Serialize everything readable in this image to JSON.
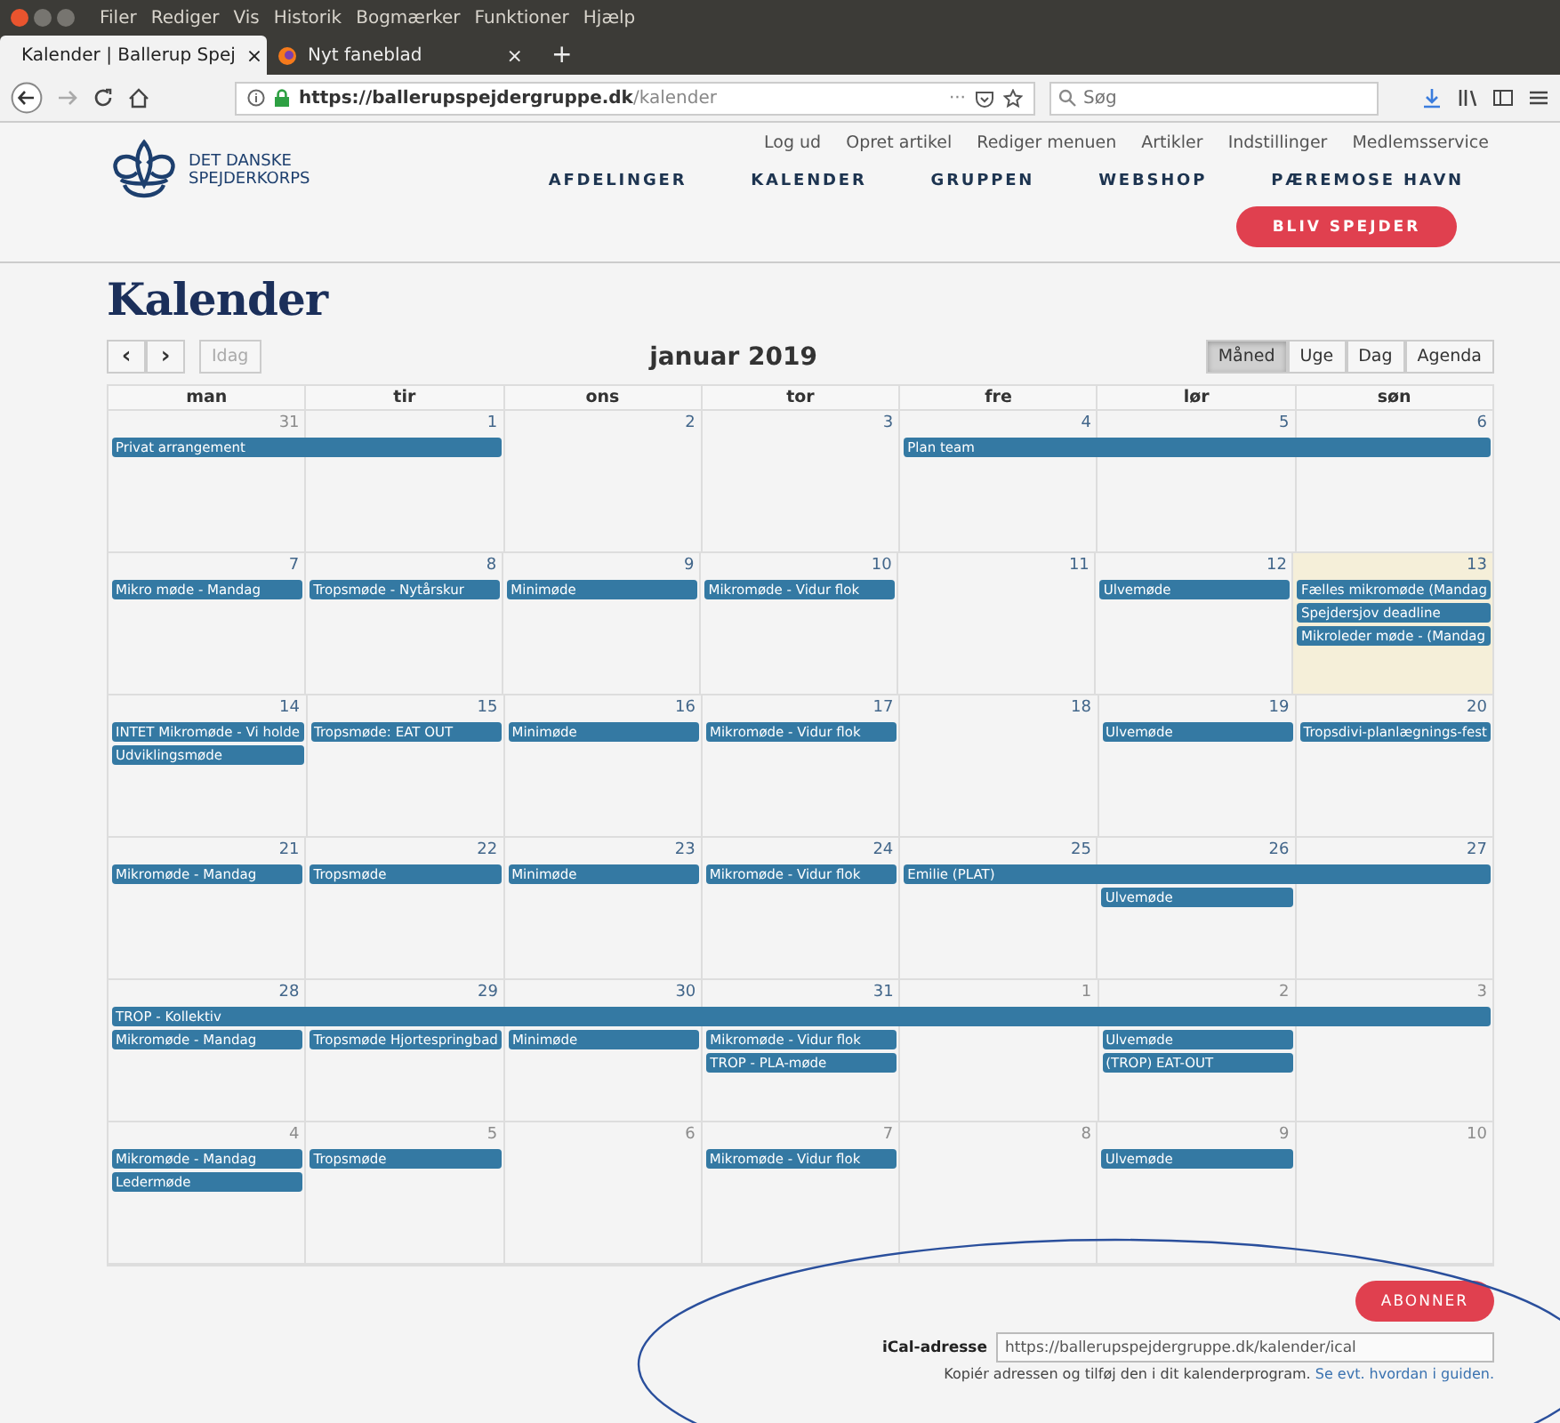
{
  "browser": {
    "menu": [
      "Filer",
      "Rediger",
      "Vis",
      "Historik",
      "Bogmærker",
      "Funktioner",
      "Hjælp"
    ],
    "tabs": [
      {
        "title": "Kalender | Ballerup Spej",
        "close": "×",
        "selected": true
      },
      {
        "title": "Nyt faneblad",
        "close": "×",
        "selected": false
      }
    ],
    "new_tab": "+",
    "url": {
      "host": "https://ballerupspejdergruppe.dk",
      "path": "/kalender"
    },
    "page_actions": "···",
    "search": {
      "placeholder": "Søg"
    }
  },
  "site": {
    "logo_text": [
      "DET DANSKE",
      "SPEJDERKORPS"
    ],
    "top_links": [
      "Log ud",
      "Opret artikel",
      "Rediger menuen",
      "Artikler",
      "Indstillinger",
      "Medlemsservice"
    ],
    "nav": [
      "AFDELINGER",
      "KALENDER",
      "GRUPPEN",
      "WEBSHOP",
      "PÆREMOSE HAVN"
    ],
    "cta": "BLIV SPEJDER"
  },
  "page_title": "Kalender",
  "toolbar": {
    "prev": "‹",
    "next": "›",
    "today": {
      "label": "Idag",
      "disabled": true
    },
    "title": "januar 2019",
    "views": [
      {
        "label": "Måned",
        "selected": true
      },
      {
        "label": "Uge",
        "selected": false
      },
      {
        "label": "Dag",
        "selected": false
      },
      {
        "label": "Agenda",
        "selected": false
      }
    ]
  },
  "calendar": {
    "weekdays": [
      "man",
      "tir",
      "ons",
      "tor",
      "fre",
      "lør",
      "søn"
    ],
    "weeks": [
      {
        "days": [
          {
            "number": "31",
            "other_month": true,
            "today": false,
            "events": [
              {
                "kind": "event",
                "title": "Privat arrangement"
              }
            ]
          },
          {
            "number": "1",
            "other_month": false,
            "today": false,
            "events": [
              {
                "kind": "continued"
              }
            ]
          },
          {
            "number": "2",
            "other_month": false,
            "today": false
          },
          {
            "number": "3",
            "other_month": false,
            "today": false
          },
          {
            "number": "4",
            "other_month": false,
            "today": false,
            "events": [
              {
                "kind": "event",
                "title": "Plan team"
              }
            ]
          },
          {
            "number": "5",
            "other_month": false,
            "today": false,
            "events": [
              {
                "kind": "continued"
              }
            ]
          },
          {
            "number": "6",
            "other_month": false,
            "today": false,
            "events": [
              {
                "kind": "continued"
              }
            ]
          }
        ]
      },
      {
        "days": [
          {
            "number": "7",
            "other_month": false,
            "today": false,
            "events": [
              {
                "kind": "event",
                "title": "Mikro møde - Mandag"
              }
            ]
          },
          {
            "number": "8",
            "other_month": false,
            "today": false,
            "events": [
              {
                "kind": "event",
                "title": "Tropsmøde - Nytårskur"
              }
            ]
          },
          {
            "number": "9",
            "other_month": false,
            "today": false,
            "events": [
              {
                "kind": "event",
                "title": "Minimøde"
              }
            ]
          },
          {
            "number": "10",
            "other_month": false,
            "today": false,
            "events": [
              {
                "kind": "event",
                "title": "Mikromøde - Vidur flok"
              }
            ]
          },
          {
            "number": "11",
            "other_month": false,
            "today": false
          },
          {
            "number": "12",
            "other_month": false,
            "today": false,
            "events": [
              {
                "kind": "event",
                "title": "Ulvemøde"
              }
            ]
          },
          {
            "number": "13",
            "other_month": false,
            "today": true,
            "events": [
              {
                "kind": "event",
                "title": "Fælles mikromøde (Mandag"
              },
              {
                "kind": "event",
                "title": "Spejdersjov deadline"
              },
              {
                "kind": "event",
                "title": "Mikroleder møde - (Mandag"
              }
            ]
          }
        ]
      },
      {
        "days": [
          {
            "number": "14",
            "other_month": false,
            "today": false,
            "events": [
              {
                "kind": "event",
                "title": "INTET Mikromøde - Vi holde"
              },
              {
                "kind": "event",
                "title": "Udviklingsmøde"
              }
            ]
          },
          {
            "number": "15",
            "other_month": false,
            "today": false,
            "events": [
              {
                "kind": "event",
                "title": "Tropsmøde: EAT OUT"
              }
            ]
          },
          {
            "number": "16",
            "other_month": false,
            "today": false,
            "events": [
              {
                "kind": "event",
                "title": "Minimøde"
              }
            ]
          },
          {
            "number": "17",
            "other_month": false,
            "today": false,
            "events": [
              {
                "kind": "event",
                "title": "Mikromøde - Vidur flok"
              }
            ]
          },
          {
            "number": "18",
            "other_month": false,
            "today": false
          },
          {
            "number": "19",
            "other_month": false,
            "today": false,
            "events": [
              {
                "kind": "event",
                "title": "Ulvemøde"
              }
            ]
          },
          {
            "number": "20",
            "other_month": false,
            "today": false,
            "events": [
              {
                "kind": "event",
                "title": "Tropsdivi-planlægnings-fest"
              }
            ]
          }
        ]
      },
      {
        "days": [
          {
            "number": "21",
            "other_month": false,
            "today": false,
            "events": [
              {
                "kind": "event",
                "title": "Mikromøde - Mandag"
              }
            ]
          },
          {
            "number": "22",
            "other_month": false,
            "today": false,
            "events": [
              {
                "kind": "event",
                "title": "Tropsmøde"
              }
            ]
          },
          {
            "number": "23",
            "other_month": false,
            "today": false,
            "events": [
              {
                "kind": "event",
                "title": "Minimøde"
              }
            ]
          },
          {
            "number": "24",
            "other_month": false,
            "today": false,
            "events": [
              {
                "kind": "event",
                "title": "Mikromøde - Vidur flok"
              }
            ]
          },
          {
            "number": "25",
            "other_month": false,
            "today": false,
            "events": [
              {
                "kind": "event",
                "title": "Emilie (PLAT)"
              }
            ]
          },
          {
            "number": "26",
            "other_month": false,
            "today": false,
            "events": [
              {
                "kind": "continued"
              },
              {
                "kind": "event",
                "title": "Ulvemøde"
              }
            ]
          },
          {
            "number": "27",
            "other_month": false,
            "today": false,
            "events": [
              {
                "kind": "continued"
              }
            ]
          }
        ]
      },
      {
        "days": [
          {
            "number": "28",
            "other_month": false,
            "today": false,
            "events": [
              {
                "kind": "event",
                "title": "TROP - Kollektiv"
              },
              {
                "kind": "event",
                "title": "Mikromøde - Mandag"
              }
            ]
          },
          {
            "number": "29",
            "other_month": false,
            "today": false,
            "events": [
              {
                "kind": "continued"
              },
              {
                "kind": "event",
                "title": "Tropsmøde Hjortespringbad"
              }
            ]
          },
          {
            "number": "30",
            "other_month": false,
            "today": false,
            "events": [
              {
                "kind": "continued"
              },
              {
                "kind": "event",
                "title": "Minimøde"
              }
            ]
          },
          {
            "number": "31",
            "other_month": false,
            "today": false,
            "events": [
              {
                "kind": "continued"
              },
              {
                "kind": "event",
                "title": "Mikromøde - Vidur flok"
              },
              {
                "kind": "event",
                "title": "TROP - PLA-møde"
              }
            ]
          },
          {
            "number": "1",
            "other_month": true,
            "today": false,
            "events": [
              {
                "kind": "continued"
              }
            ]
          },
          {
            "number": "2",
            "other_month": true,
            "today": false,
            "events": [
              {
                "kind": "continued"
              },
              {
                "kind": "event",
                "title": "Ulvemøde"
              },
              {
                "kind": "event",
                "title": "(TROP) EAT-OUT"
              }
            ]
          },
          {
            "number": "3",
            "other_month": true,
            "today": false,
            "events": [
              {
                "kind": "continued"
              }
            ]
          }
        ]
      },
      {
        "days": [
          {
            "number": "4",
            "other_month": true,
            "today": false,
            "events": [
              {
                "kind": "event",
                "title": "Mikromøde - Mandag"
              },
              {
                "kind": "event",
                "title": "Ledermøde"
              }
            ]
          },
          {
            "number": "5",
            "other_month": true,
            "today": false,
            "events": [
              {
                "kind": "event",
                "title": "Tropsmøde"
              }
            ]
          },
          {
            "number": "6",
            "other_month": true,
            "today": false
          },
          {
            "number": "7",
            "other_month": true,
            "today": false,
            "events": [
              {
                "kind": "event",
                "title": "Mikromøde - Vidur flok"
              }
            ]
          },
          {
            "number": "8",
            "other_month": true,
            "today": false
          },
          {
            "number": "9",
            "other_month": true,
            "today": false,
            "events": [
              {
                "kind": "event",
                "title": "Ulvemøde"
              }
            ]
          },
          {
            "number": "10",
            "other_month": true,
            "today": false
          }
        ]
      }
    ]
  },
  "ical": {
    "button": "ABONNER",
    "label": "iCal-adresse",
    "value": "https://ballerupspejdergruppe.dk/kalender/ical",
    "hint": "Kopiér adressen og tilføj den i dit kalenderprogram.",
    "link": "Se evt. hvordan i guiden."
  }
}
